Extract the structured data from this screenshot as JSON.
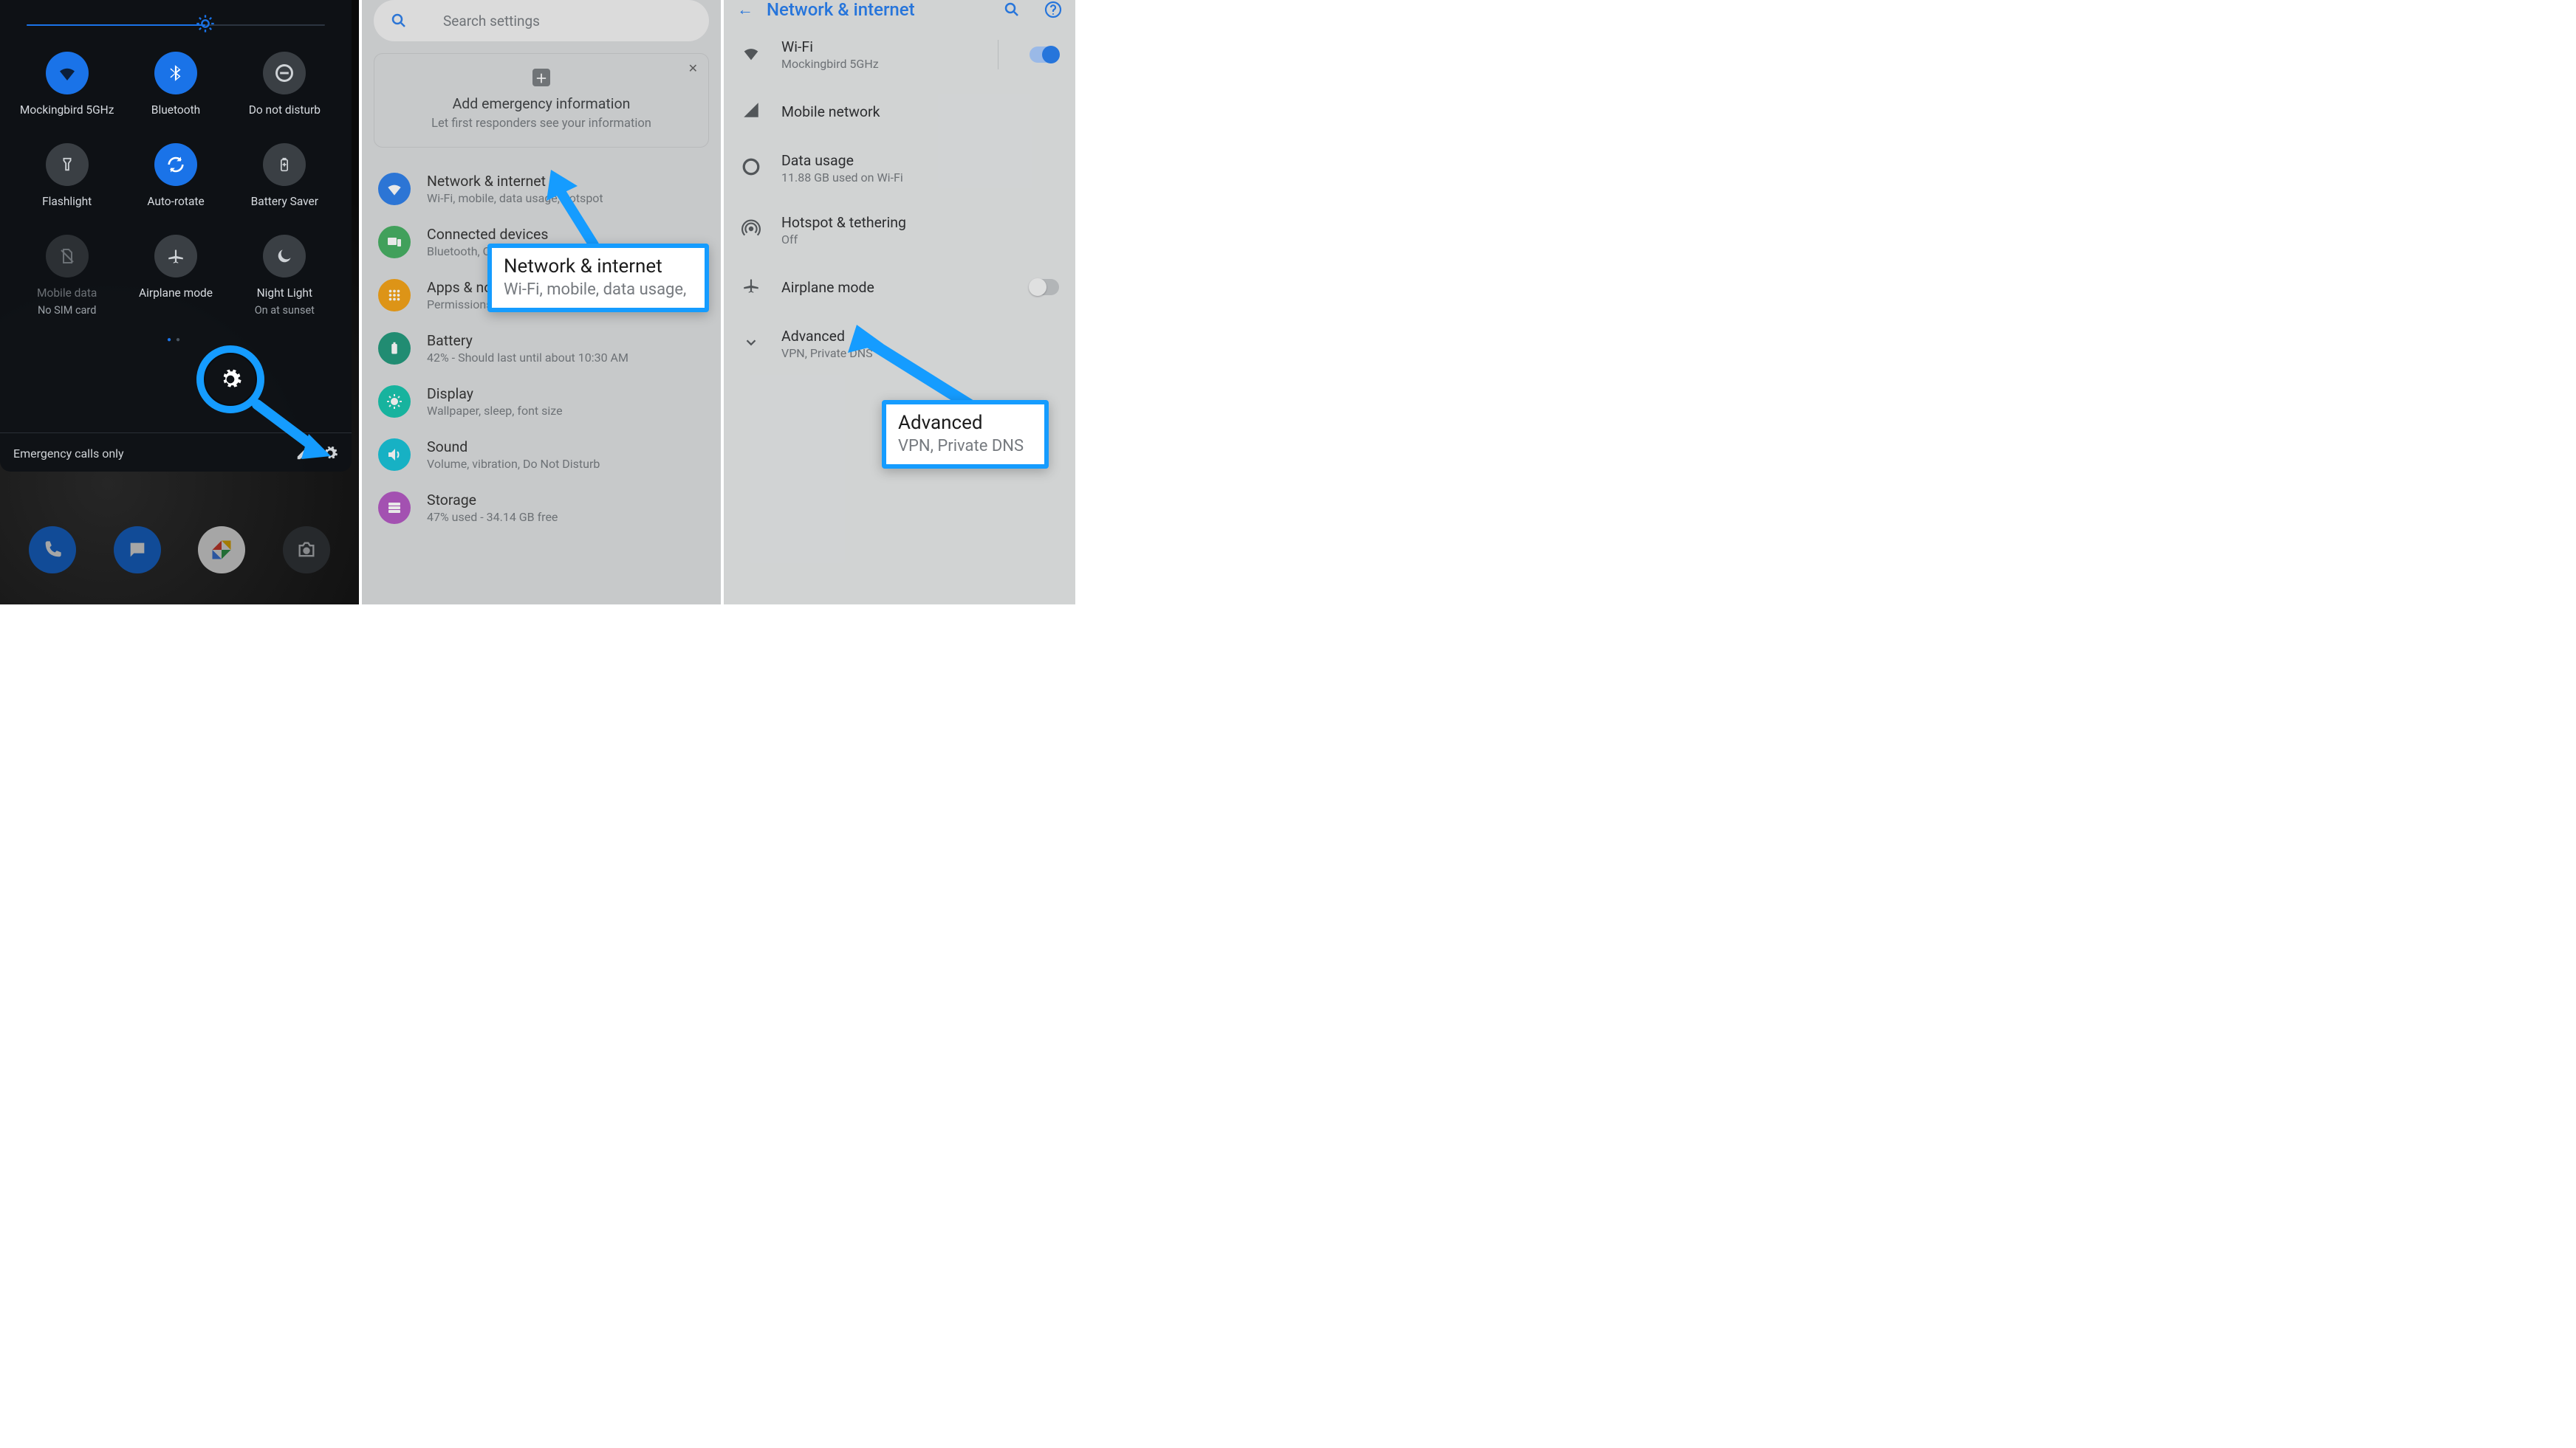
{
  "colors": {
    "accent": "#1a73e8",
    "callout": "#159cff"
  },
  "quick_settings": {
    "brightness_pct": 60,
    "tiles": [
      {
        "name": "wifi",
        "label": "Mockingbird 5GHz",
        "sub": "",
        "state": "on"
      },
      {
        "name": "bluetooth",
        "label": "Bluetooth",
        "sub": "",
        "state": "on"
      },
      {
        "name": "dnd",
        "label": "Do not disturb",
        "sub": "",
        "state": "off"
      },
      {
        "name": "flashlight",
        "label": "Flashlight",
        "sub": "",
        "state": "off"
      },
      {
        "name": "autorotate",
        "label": "Auto-rotate",
        "sub": "",
        "state": "on"
      },
      {
        "name": "battery",
        "label": "Battery Saver",
        "sub": "",
        "state": "off"
      },
      {
        "name": "mobiledata",
        "label": "Mobile data",
        "sub": "No SIM card",
        "state": "disabled"
      },
      {
        "name": "airplane",
        "label": "Airplane mode",
        "sub": "",
        "state": "off"
      },
      {
        "name": "nightlight",
        "label": "Night Light",
        "sub": "On at sunset",
        "state": "off"
      }
    ],
    "pager_active": 0,
    "footer_status": "Emergency calls only"
  },
  "settings": {
    "search_placeholder": "Search settings",
    "emergency": {
      "title": "Add emergency information",
      "subtitle": "Let first responders see your information"
    },
    "rows": [
      {
        "icon": "net",
        "title": "Network & internet",
        "sub": "Wi-Fi, mobile, data usage, hotspot"
      },
      {
        "icon": "con",
        "title": "Connected devices",
        "sub": "Bluetooth, Cast, NFC"
      },
      {
        "icon": "app",
        "title": "Apps & notifications",
        "sub": "Permissions, default apps"
      },
      {
        "icon": "bat",
        "title": "Battery",
        "sub": "42% - Should last until about 10:30 AM"
      },
      {
        "icon": "dis",
        "title": "Display",
        "sub": "Wallpaper, sleep, font size"
      },
      {
        "icon": "snd",
        "title": "Sound",
        "sub": "Volume, vibration, Do Not Disturb"
      },
      {
        "icon": "sto",
        "title": "Storage",
        "sub": "47% used - 34.14 GB free"
      }
    ]
  },
  "network": {
    "title": "Network & internet",
    "rows": [
      {
        "icon": "wifi",
        "title": "Wi-Fi",
        "sub": "Mockingbird 5GHz",
        "toggle": "on"
      },
      {
        "icon": "cell",
        "title": "Mobile network",
        "sub": ""
      },
      {
        "icon": "data",
        "title": "Data usage",
        "sub": "11.88 GB used on Wi-Fi"
      },
      {
        "icon": "hotspot",
        "title": "Hotspot & tethering",
        "sub": "Off"
      },
      {
        "icon": "airplane",
        "title": "Airplane mode",
        "sub": "",
        "toggle": "off"
      },
      {
        "icon": "chev",
        "title": "Advanced",
        "sub": "VPN, Private DNS"
      }
    ]
  },
  "callouts": {
    "box1": {
      "title": "Network & internet",
      "sub": "Wi-Fi, mobile, data usage,"
    },
    "box2": {
      "title": "Advanced",
      "sub": "VPN, Private DNS"
    }
  }
}
